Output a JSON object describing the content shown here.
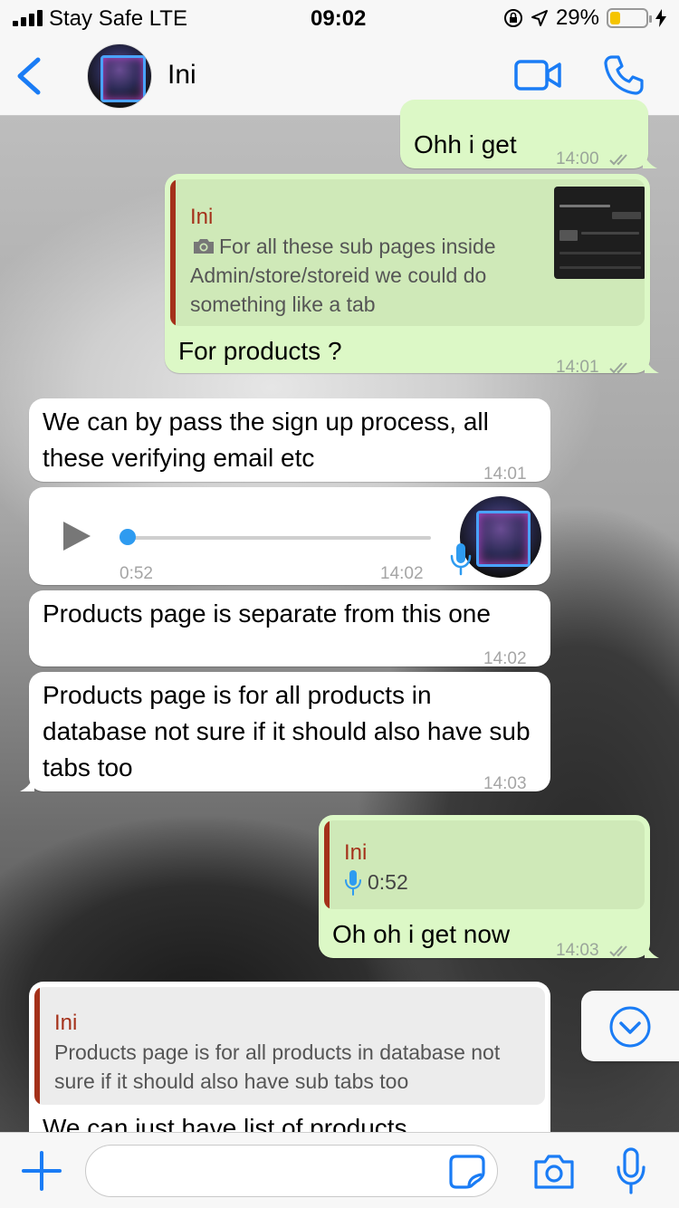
{
  "status_bar": {
    "carrier": "Stay Safe  LTE",
    "time": "09:02",
    "battery_percent": "29%",
    "battery_level": 0.29,
    "battery_color": "#f5c400",
    "icons": [
      "signal-icon",
      "orientation-lock-icon",
      "location-icon",
      "battery-icon",
      "charging-icon"
    ]
  },
  "header": {
    "back_icon": "chevron-left-icon",
    "contact_name": "Ini",
    "actions": [
      "video-call-icon",
      "phone-icon"
    ],
    "accent": "#1a7cf5"
  },
  "messages": [
    {
      "dir": "out",
      "text": "Ohh i get",
      "time": "14:00",
      "read": true
    },
    {
      "dir": "out",
      "quote": {
        "author": "Ini",
        "text": "For all these sub pages inside Admin/store/storeid we could do something like a tab",
        "has_photo": true
      },
      "text": "For products ?",
      "time": "14:01",
      "read": true
    },
    {
      "dir": "in",
      "text": "We can by pass the sign up process, all these verifying email etc",
      "time": "14:01"
    },
    {
      "dir": "in",
      "voice": {
        "duration": "0:52",
        "progress": 0.0
      },
      "time": "14:02"
    },
    {
      "dir": "in",
      "text": "Products page is separate from this one",
      "time": "14:02"
    },
    {
      "dir": "in",
      "text": "Products page is for all products in database not sure if it should also have sub tabs too",
      "time": "14:03"
    },
    {
      "dir": "out",
      "quote": {
        "author": "Ini",
        "text": "0:52",
        "voice": true
      },
      "text": "Oh oh i get now",
      "time": "14:03",
      "read": true
    },
    {
      "dir": "in",
      "quote": {
        "author": "Ini",
        "text": "Products page is for all products in database not sure if it should also have sub tabs too"
      },
      "text": "We can just have list of products"
    }
  ],
  "input_bar": {
    "placeholder": "",
    "icons": [
      "plus-icon",
      "sticker-icon",
      "camera-icon",
      "microphone-icon"
    ]
  },
  "colors": {
    "outgoing_bubble": "#dcf8c6",
    "incoming_bubble": "#ffffff",
    "quote_author": "#a4311a",
    "voice_accent": "#2e9bf0"
  }
}
